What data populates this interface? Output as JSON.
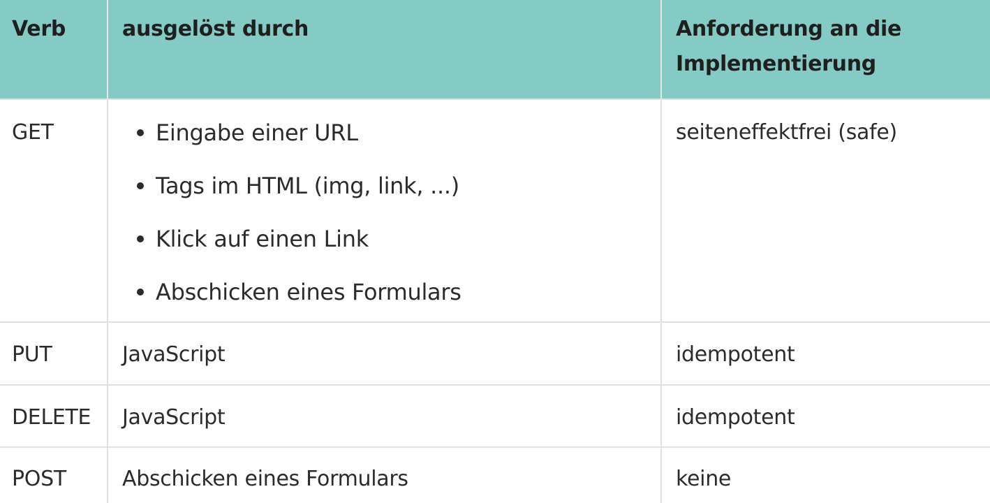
{
  "table": {
    "headers": {
      "verb": "Verb",
      "trigger": "ausgelöst durch",
      "requirement": "Anforderung an die Implementierung"
    },
    "rows": [
      {
        "verb": "GET",
        "triggers": [
          "Eingabe einer URL",
          "Tags im HTML (img, link, ...)",
          "Klick auf einen Link",
          "Abschicken eines Formulars"
        ],
        "requirement": "seiteneffektfrei (safe)"
      },
      {
        "verb": "PUT",
        "trigger": "JavaScript",
        "requirement": "idempotent"
      },
      {
        "verb": "DELETE",
        "trigger": "JavaScript",
        "requirement": "idempotent"
      },
      {
        "verb": "POST",
        "trigger": "Abschicken eines Formulars",
        "requirement": "keine"
      }
    ]
  },
  "colors": {
    "header_background": "#84cbc5",
    "border": "#e0e0e0",
    "text": "#2b2b2b"
  }
}
